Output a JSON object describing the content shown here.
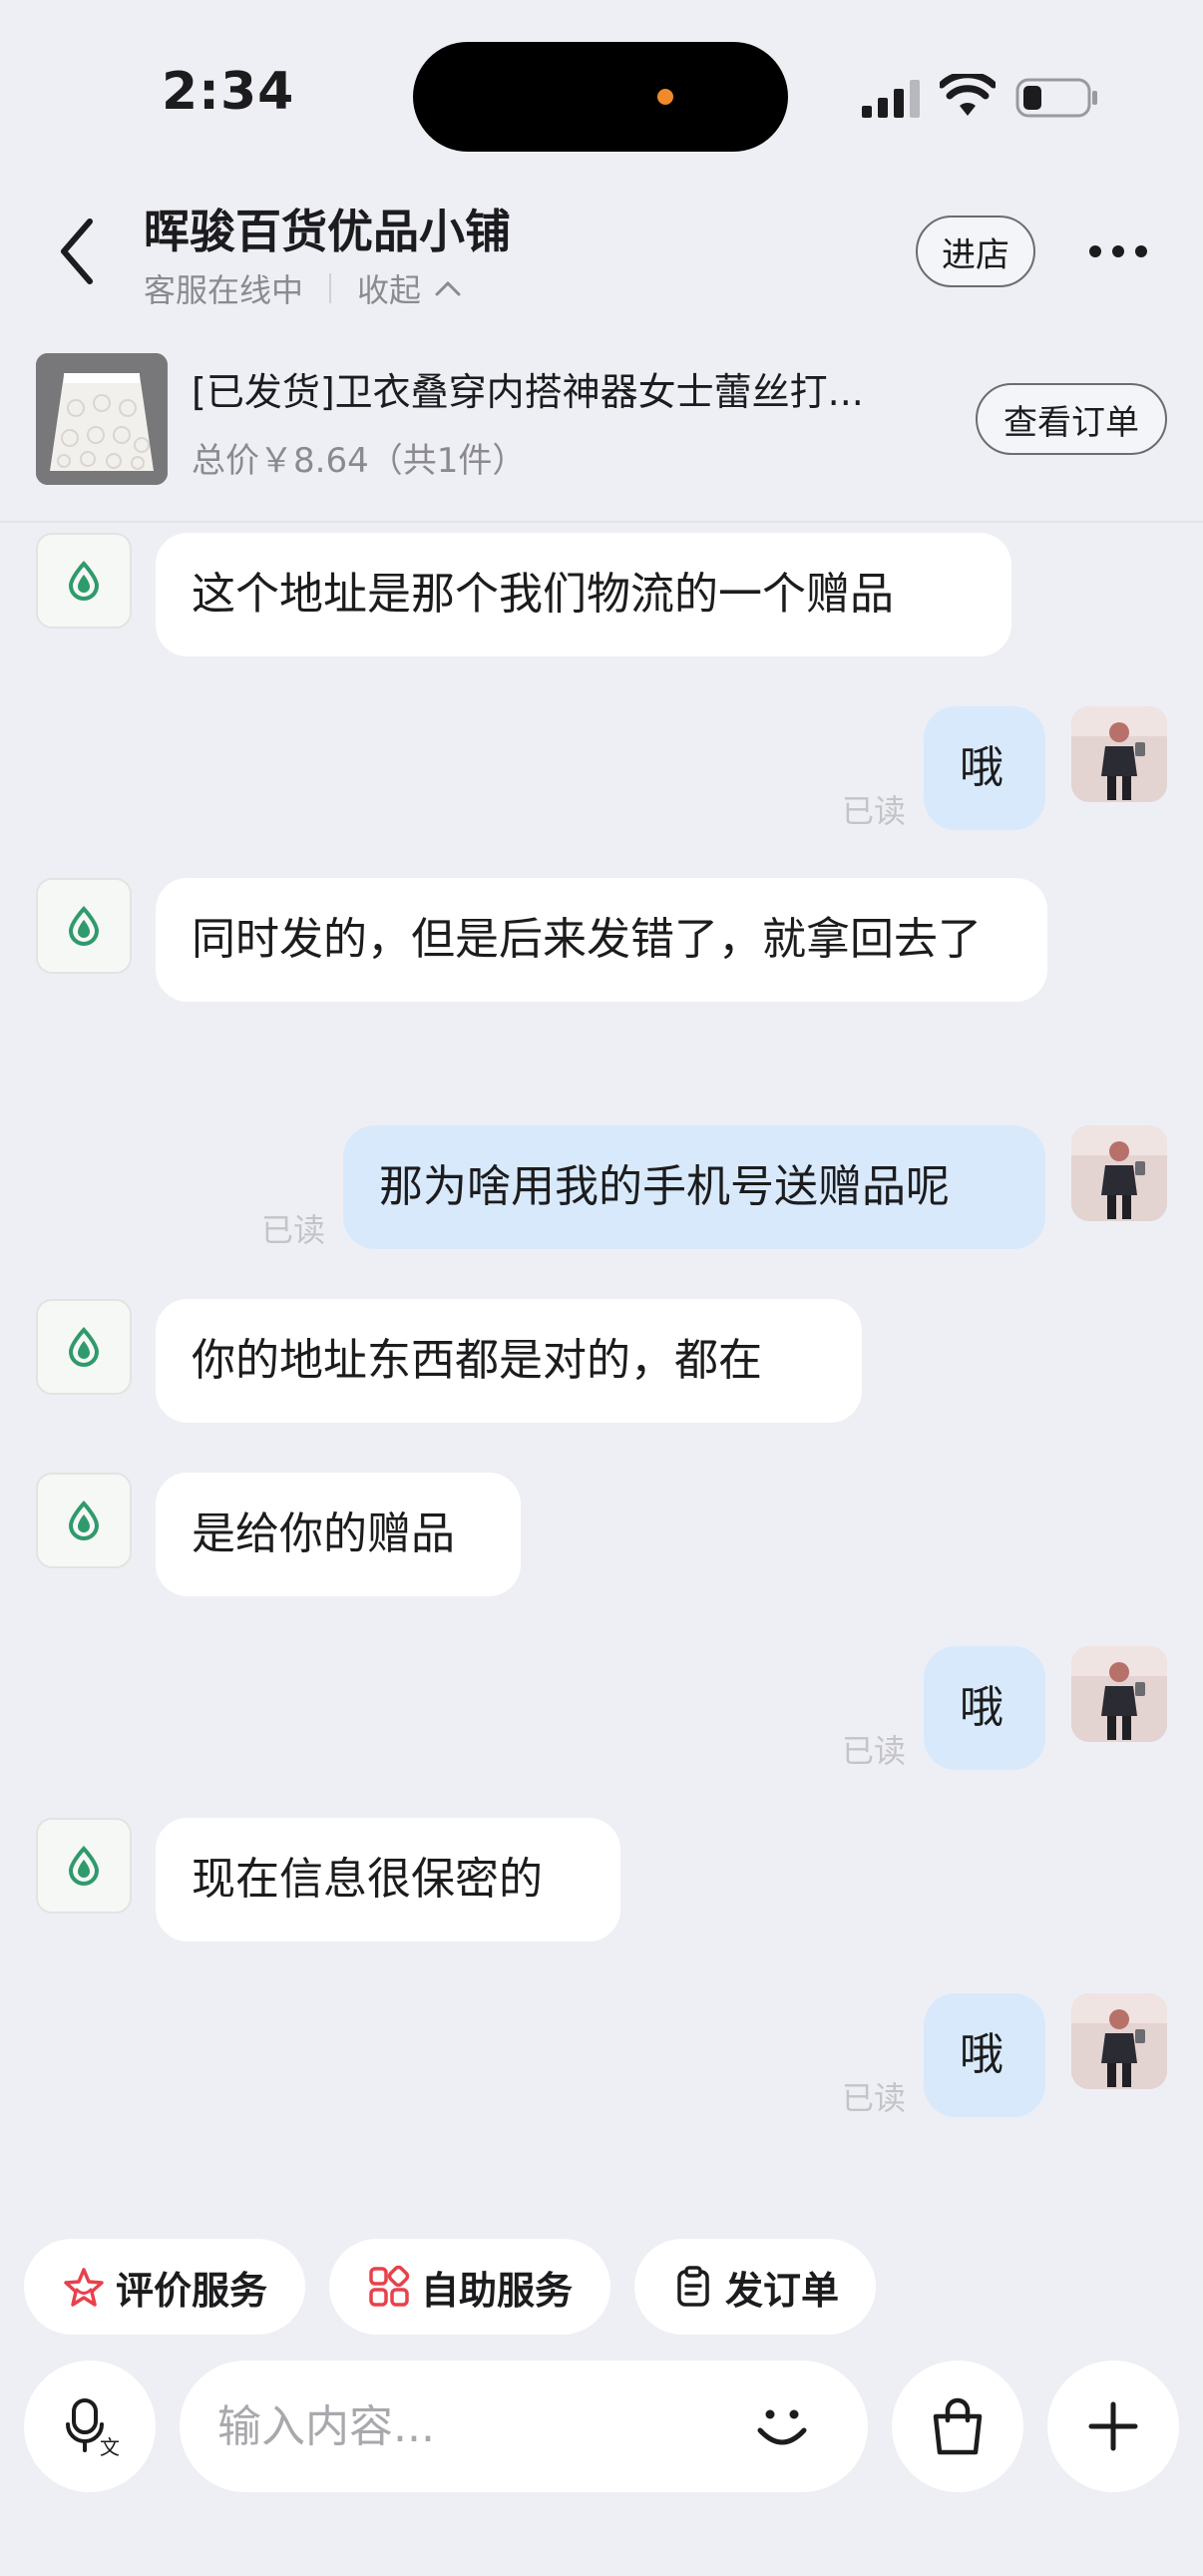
{
  "status_bar": {
    "time": "2:34"
  },
  "header": {
    "shop_name": "晖骏百货优品小铺",
    "service_status": "客服在线中",
    "collapse_label": "收起",
    "enter_store_label": "进店"
  },
  "order": {
    "title": "[已发货]卫衣叠穿内搭神器女士蕾丝打...",
    "price": "总价￥8.64（共1件）",
    "view_order_label": "查看订单"
  },
  "messages": [
    {
      "side": "in",
      "text": "这个地址是那个我们物流的一个赠品"
    },
    {
      "side": "out",
      "text": "哦",
      "status": "已读"
    },
    {
      "side": "in",
      "text": "同时发的，但是后来发错了，就拿回去了"
    },
    {
      "side": "out",
      "text": "那为啥用我的手机号送赠品呢",
      "status": "已读"
    },
    {
      "side": "in",
      "text": "你的地址东西都是对的，都在"
    },
    {
      "side": "in",
      "text": "是给你的赠品"
    },
    {
      "side": "out",
      "text": "哦",
      "status": "已读"
    },
    {
      "side": "in",
      "text": "现在信息很保密的"
    },
    {
      "side": "out",
      "text": "哦",
      "status": "已读"
    }
  ],
  "quick_actions": [
    {
      "label": "评价服务",
      "icon": "star-icon"
    },
    {
      "label": "自助服务",
      "icon": "grid-icon"
    },
    {
      "label": "发订单",
      "icon": "clipboard-icon"
    }
  ],
  "input": {
    "placeholder": "输入内容..."
  },
  "colors": {
    "bubble_out": "#d8e9fb",
    "bubble_in": "#ffffff",
    "background": "#eeeff4",
    "accent_red": "#e8414b",
    "shop_icon_green": "#2f9a6b"
  }
}
